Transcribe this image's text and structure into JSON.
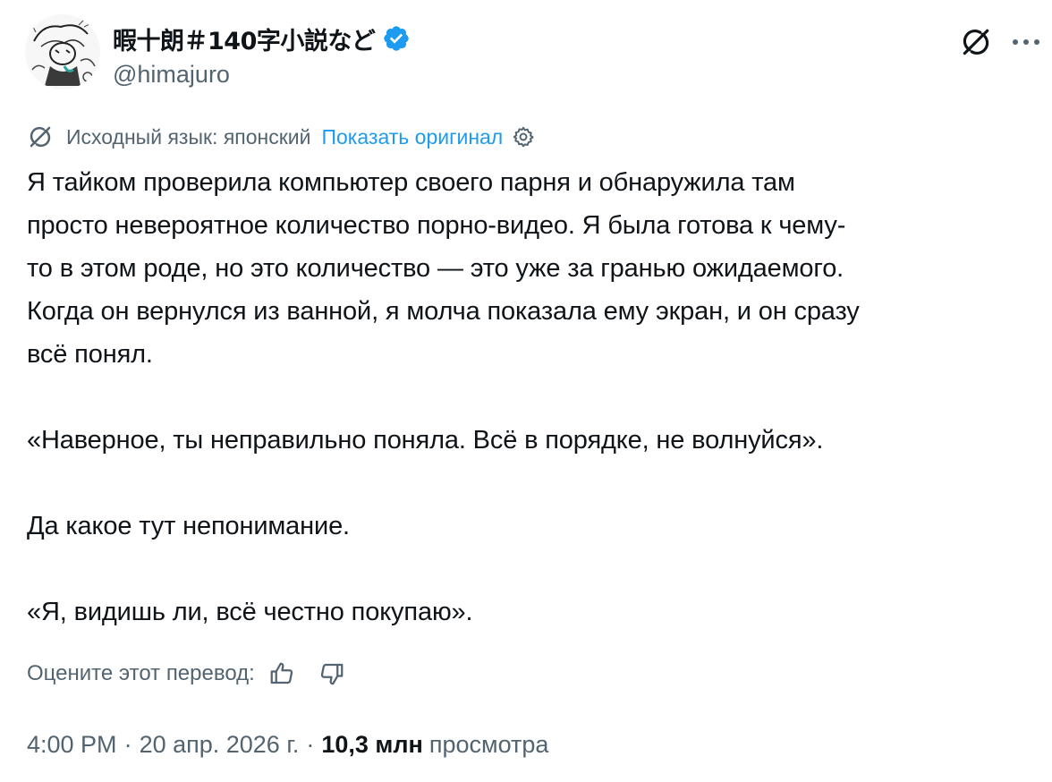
{
  "author": {
    "display_name": "暇十朗＃140字小説など",
    "handle": "@himajuro",
    "verified": true,
    "avatar_icon": "sketch-avatar-icon"
  },
  "header_actions": {
    "grok_icon": "grok-icon",
    "more_icon": "more-icon"
  },
  "translation": {
    "source_language": "Исходный язык: японский",
    "show_original": "Показать оригинал",
    "settings_icon": "gear-icon"
  },
  "tweet": {
    "paragraphs": [
      "Я тайком проверила компьютер своего парня и обнаружила там просто невероятное количество порно-видео. Я была готова к чему-то в этом роде, но это количество — это уже за гранью ожидаемого. Когда он вернулся из ванной, я молча показала ему экран, и он сразу всё понял.",
      "«Наверное, ты неправильно поняла. Всё в порядке, не волнуйся».",
      "Да какое тут непонимание.",
      "«Я, видишь ли, всё честно покупаю»."
    ],
    "lines": [
      "Я тайком проверила компьютер своего парня и обнаружила там",
      "просто невероятное количество порно-видео. Я была готова к чему-",
      "то в этом роде, но это количество — это уже за гранью ожидаемого.",
      "Когда он вернулся из ванной, я молча показала ему экран, и он сразу",
      "всё понял."
    ]
  },
  "rating": {
    "label": "Оцените этот перевод:",
    "thumbs_up_icon": "thumbs-up-icon",
    "thumbs_down_icon": "thumbs-down-icon"
  },
  "meta": {
    "time": "4:00 PM",
    "date": "20 апр. 2026 г.",
    "separator": "·",
    "views_count": "10,3 млн",
    "views_label": "просмотра"
  },
  "colors": {
    "text_primary": "#0f1419",
    "text_secondary": "#536471",
    "accent": "#1d9bf0",
    "background": "#ffffff"
  }
}
